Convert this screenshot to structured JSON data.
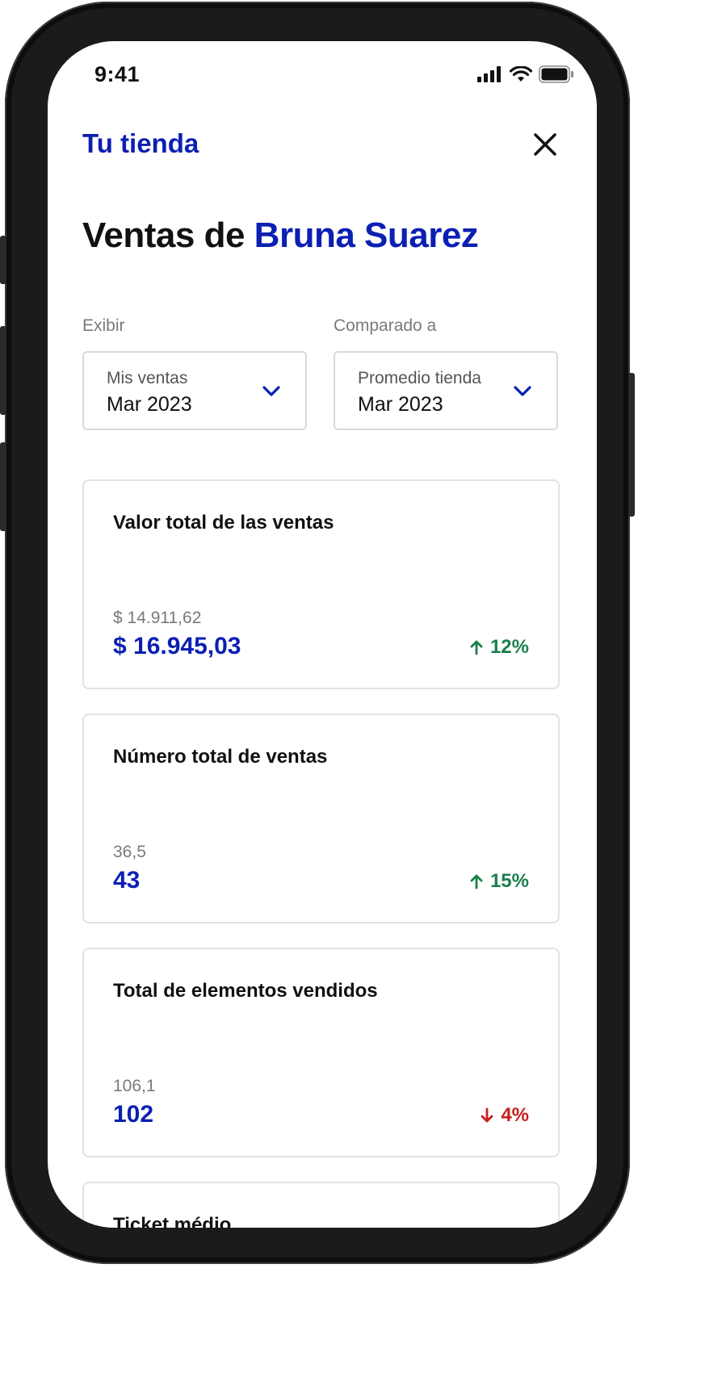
{
  "status_bar": {
    "time": "9:41",
    "icons": [
      "signal-icon",
      "wifi-icon",
      "battery-icon"
    ]
  },
  "header": {
    "store_link": "Tu tienda",
    "close_icon": "close-icon"
  },
  "title": {
    "prefix": "Ventas de",
    "name": "Bruna Suarez"
  },
  "filters": {
    "show": {
      "label": "Exibir",
      "selected_group": "Mis ventas",
      "selected_period": "Mar 2023"
    },
    "compare": {
      "label": "Comparado a",
      "selected_group": "Promedio tienda",
      "selected_period": "Mar 2023"
    }
  },
  "cards": [
    {
      "title": "Valor total de las ventas",
      "previous": "$ 14.911,62",
      "value": "$ 16.945,03",
      "change": "12%",
      "direction": "up"
    },
    {
      "title": "Número total de ventas",
      "previous": "36,5",
      "value": "43",
      "change": "15%",
      "direction": "up"
    },
    {
      "title": "Total de elementos vendidos",
      "previous": "106,1",
      "value": "102",
      "change": "4%",
      "direction": "down"
    },
    {
      "title": "Ticket médio"
    }
  ],
  "colors": {
    "accent": "#0b1fb3",
    "up": "#1a7f4b",
    "down": "#c81e1e",
    "muted": "#7a7a7a"
  }
}
